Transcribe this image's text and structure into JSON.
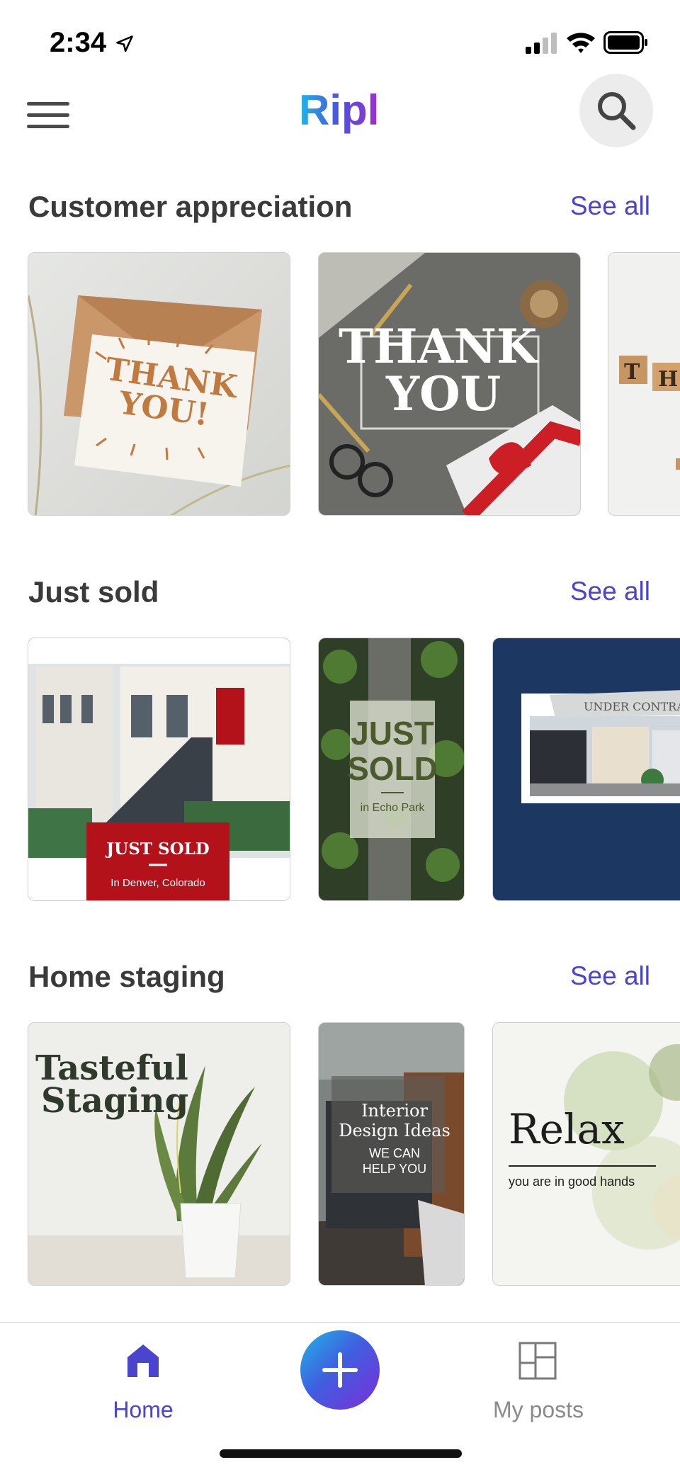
{
  "status_bar": {
    "time": "2:34"
  },
  "header": {
    "logo_text": "Ripl"
  },
  "sections": [
    {
      "title": "Customer appreciation",
      "see_all": "See all",
      "cards": [
        {
          "text": [
            "THANK",
            "YOU!"
          ]
        },
        {
          "text": [
            "THANK",
            "YOU"
          ]
        },
        {
          "text": [
            "T",
            "H"
          ]
        }
      ]
    },
    {
      "title": "Just sold",
      "see_all": "See all",
      "cards": [
        {
          "headline": "JUST SOLD",
          "subline": "In Denver, Colorado"
        },
        {
          "headline": [
            "JUST",
            "SOLD"
          ],
          "subline": "in Echo Park"
        },
        {
          "headline": "UNDER CONTRACT"
        }
      ]
    },
    {
      "title": "Home staging",
      "see_all": "See all",
      "cards": [
        {
          "headline": [
            "Tasteful",
            "Staging"
          ]
        },
        {
          "headline": [
            "Interior",
            "Design Ideas"
          ],
          "subline": [
            "WE CAN",
            "HELP YOU"
          ]
        },
        {
          "headline": "Relax",
          "subline": "you are in good hands"
        }
      ]
    }
  ],
  "bottom_nav": {
    "home_label": "Home",
    "posts_label": "My posts",
    "active_color": "#4a44cf",
    "inactive_color": "#8a8a8a"
  },
  "colors": {
    "accent": "#4a44cf",
    "sold_red": "#b3121b",
    "navy": "#1c3761"
  }
}
